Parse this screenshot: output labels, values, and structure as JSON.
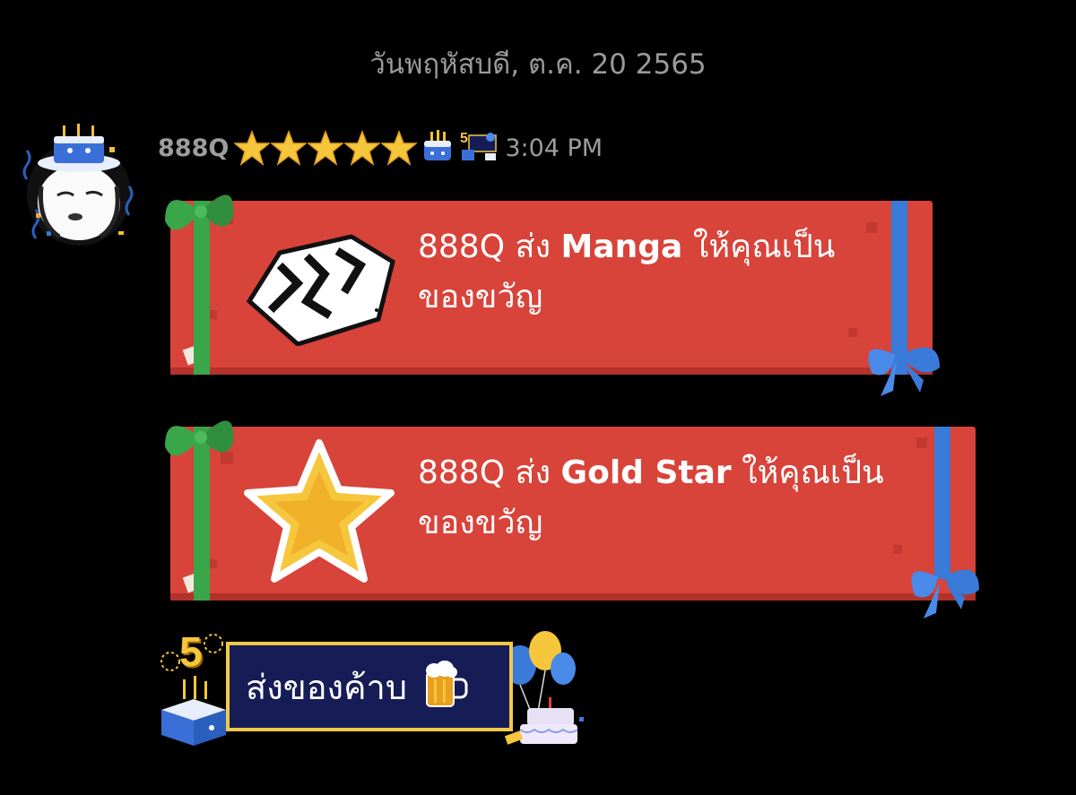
{
  "date_separator": "วันพฤหัสบดี, ต.ค. 20 2565",
  "message": {
    "username": "888Q",
    "time": "3:04 PM",
    "stars": 5,
    "avatar_icon": "birthday-cake-hat-avatar"
  },
  "gifts": [
    {
      "sender": "888Q",
      "verb": "ส่ง",
      "item": "Manga",
      "suffix": "ให้คุณเป็น",
      "line2": "ของขวัญ",
      "icon": "manga-icon"
    },
    {
      "sender": "888Q",
      "verb": "ส่ง",
      "item": "Gold Star",
      "suffix": "ให้คุณเป็น",
      "line2": "ของขวัญ",
      "icon": "gold-star-icon"
    }
  ],
  "reply_button": {
    "label": "ส่งของค้าบ",
    "icon": "beer-mug-icon",
    "badge_number": "5"
  },
  "colors": {
    "card_red": "#d8433a",
    "ribbon_green": "#3aa64a",
    "ribbon_blue": "#3a7ad8",
    "gold": "#f6c63c",
    "reply_bg": "#151c56"
  }
}
